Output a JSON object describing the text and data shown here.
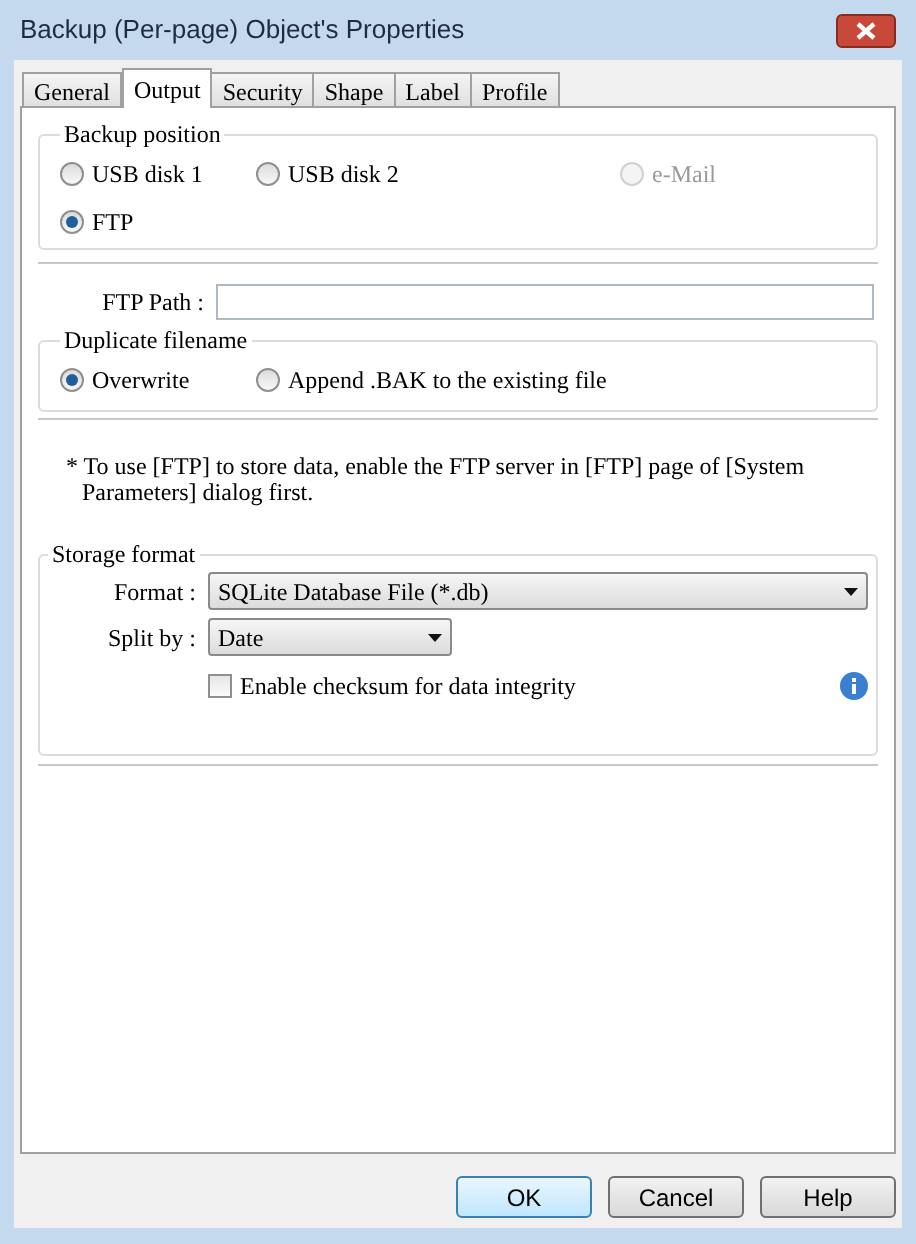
{
  "window": {
    "title": "Backup (Per-page) Object's Properties"
  },
  "tabs": [
    {
      "label": "General",
      "selected": false
    },
    {
      "label": "Output",
      "selected": true
    },
    {
      "label": "Security",
      "selected": false
    },
    {
      "label": "Shape",
      "selected": false
    },
    {
      "label": "Label",
      "selected": false
    },
    {
      "label": "Profile",
      "selected": false
    }
  ],
  "backup_position": {
    "title": "Backup position",
    "options": [
      {
        "label": "USB disk 1",
        "selected": false,
        "disabled": false
      },
      {
        "label": "USB disk 2",
        "selected": false,
        "disabled": false
      },
      {
        "label": "e-Mail",
        "selected": false,
        "disabled": true
      },
      {
        "label": "FTP",
        "selected": true,
        "disabled": false
      }
    ]
  },
  "ftp_path": {
    "label": "FTP Path :"
  },
  "duplicate_filename": {
    "title": "Duplicate filename",
    "options": [
      {
        "label": "Overwrite",
        "selected": true
      },
      {
        "label": "Append .BAK to the existing file",
        "selected": false
      }
    ]
  },
  "note": "* To use [FTP] to store data, enable the FTP server in [FTP] page of [System Parameters] dialog first.",
  "storage_format": {
    "title": "Storage format",
    "format_label": "Format :",
    "format_value": "SQLite Database File (*.db)",
    "split_label": "Split by :",
    "split_value": "Date",
    "checksum": {
      "label": "Enable checksum for data integrity",
      "checked": false
    }
  },
  "buttons": [
    {
      "label": "OK",
      "default": true
    },
    {
      "label": "Cancel",
      "default": false
    },
    {
      "label": "Help",
      "default": false
    }
  ]
}
